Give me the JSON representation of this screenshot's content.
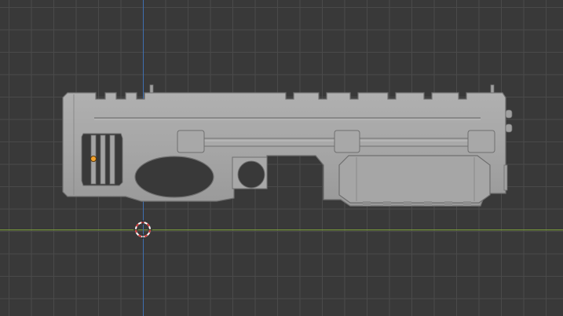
{
  "viewport": {
    "background_color": "#393939",
    "grid_color": "#4a4a4a",
    "x_axis_color": "#7fa33a",
    "y_axis_color": "#3f6fb0"
  },
  "model": {
    "fill_color": "#a3a3a3",
    "edge_color": "#6f6f6f",
    "cutout_color": "#393939"
  },
  "cursor": {
    "icon": "3d-cursor-icon",
    "color_red": "#d23b3b",
    "color_white": "#ffffff"
  },
  "origin": {
    "icon": "object-origin-icon",
    "color": "#f2a12c"
  }
}
